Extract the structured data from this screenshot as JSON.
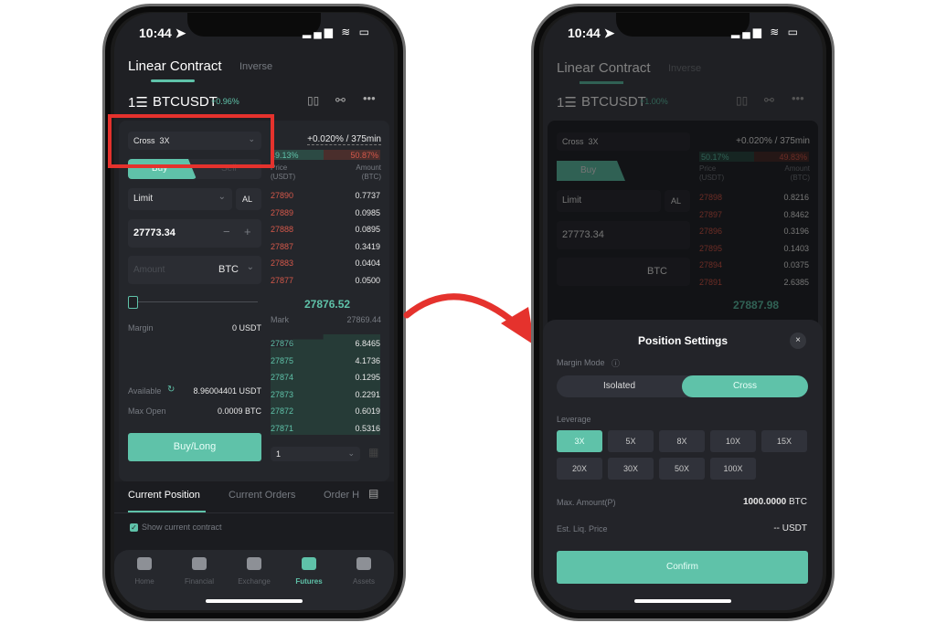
{
  "colors": {
    "accent": "#5fc2a9",
    "ask": "#d5584a",
    "highlight": "#e5322d"
  },
  "status": {
    "time": "10:44 ➤",
    "icons": "▂▄▆ ≋ ▭"
  },
  "left": {
    "tabs": {
      "active": "Linear Contract",
      "inactive": "Inverse"
    },
    "symbol": {
      "icon": "1☰",
      "name": "BTCUSDT",
      "change": "+0.96%",
      "icons": [
        "candle-icon",
        "link-icon",
        "more-icon"
      ]
    },
    "margin_mode": "Cross  3X",
    "buy": "Buy",
    "sell": "Sell",
    "order_type": "Limit",
    "al": "AL",
    "price": "27773.34",
    "amount_placeholder": "Amount",
    "amount_unit": "BTC",
    "margin_label": "Margin",
    "margin_value": "0 USDT",
    "available_label": "Available",
    "available_value": "8.96004401 USDT",
    "max_open_label": "Max Open",
    "max_open_value": "0.0009 BTC",
    "buy_long": "Buy/Long",
    "funding": "+0.020% / 375min",
    "buy_ratio": "49.13%",
    "sell_ratio": "50.87%",
    "price_header": "Price\n(USDT)",
    "amount_header": "Amount\n(BTC)",
    "asks": [
      [
        "27890",
        "0.7737"
      ],
      [
        "27889",
        "0.0985"
      ],
      [
        "27888",
        "0.0895"
      ],
      [
        "27887",
        "0.3419"
      ],
      [
        "27883",
        "0.0404"
      ],
      [
        "27877",
        "0.0500"
      ]
    ],
    "last_price": "27876.52",
    "mark_label": "Mark",
    "mark_value": "27869.44",
    "bids": [
      [
        "27876",
        "6.8465"
      ],
      [
        "27875",
        "4.1736"
      ],
      [
        "27874",
        "0.1295"
      ],
      [
        "27873",
        "0.2291"
      ],
      [
        "27872",
        "0.6019"
      ],
      [
        "27871",
        "0.5316"
      ]
    ],
    "depth_select": "1",
    "bottom_tabs": [
      "Current Position",
      "Current Orders",
      "Order H"
    ],
    "show_current": "Show current contract",
    "nav": [
      "Home",
      "Financial",
      "Exchange",
      "Futures",
      "Assets"
    ]
  },
  "right": {
    "tabs": {
      "active": "Linear Contract",
      "inactive": "Inverse"
    },
    "symbol": {
      "name": "BTCUSDT",
      "change": "+1.00%"
    },
    "margin_mode": "Cross  3X",
    "buy": "Buy",
    "order_type": "Limit",
    "al": "AL",
    "price": "27773.34",
    "amount_unit": "BTC",
    "funding": "+0.020% / 375min",
    "buy_ratio": "50.17%",
    "sell_ratio": "49.83%",
    "asks": [
      [
        "27898",
        "0.8216"
      ],
      [
        "27897",
        "0.8462"
      ],
      [
        "27896",
        "0.3196"
      ],
      [
        "27895",
        "0.1403"
      ],
      [
        "27894",
        "0.0375"
      ],
      [
        "27891",
        "2.6385"
      ]
    ],
    "last_price": "27887.98",
    "modal": {
      "title": "Position Settings",
      "margin_mode_label": "Margin Mode",
      "modes": [
        "Isolated",
        "Cross"
      ],
      "selected_mode": "Cross",
      "leverage_label": "Leverage",
      "leverage": [
        "3X",
        "5X",
        "8X",
        "10X",
        "15X",
        "20X",
        "30X",
        "50X",
        "100X"
      ],
      "selected_leverage": "3X",
      "max_amount_label": "Max. Amount(P)",
      "max_amount_value": "1000.0000",
      "max_amount_unit": "BTC",
      "liq_label": "Est. Liq. Price",
      "liq_value": "-- USDT",
      "confirm": "Confirm"
    }
  }
}
